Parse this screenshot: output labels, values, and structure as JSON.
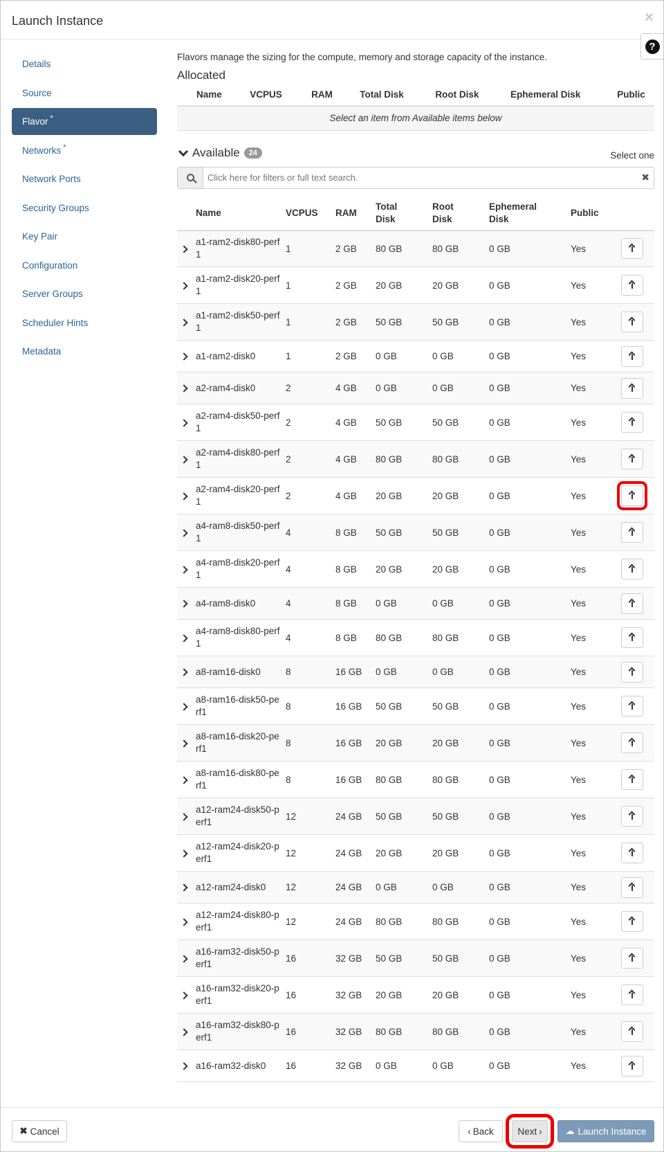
{
  "modal": {
    "title": "Launch Instance",
    "close": "×",
    "help": "?"
  },
  "sidebar": {
    "items": [
      {
        "label": "Details",
        "required": false,
        "active": false
      },
      {
        "label": "Source",
        "required": false,
        "active": false
      },
      {
        "label": "Flavor",
        "required": true,
        "active": true
      },
      {
        "label": "Networks",
        "required": true,
        "active": false
      },
      {
        "label": "Network Ports",
        "required": false,
        "active": false
      },
      {
        "label": "Security Groups",
        "required": false,
        "active": false
      },
      {
        "label": "Key Pair",
        "required": false,
        "active": false
      },
      {
        "label": "Configuration",
        "required": false,
        "active": false
      },
      {
        "label": "Server Groups",
        "required": false,
        "active": false
      },
      {
        "label": "Scheduler Hints",
        "required": false,
        "active": false
      },
      {
        "label": "Metadata",
        "required": false,
        "active": false
      }
    ],
    "required_mark": "*"
  },
  "flavor": {
    "description": "Flavors manage the sizing for the compute, memory and storage capacity of the instance.",
    "allocated": {
      "title": "Allocated",
      "columns": [
        "Name",
        "VCPUS",
        "RAM",
        "Total Disk",
        "Root Disk",
        "Ephemeral Disk",
        "Public"
      ],
      "empty_message": "Select an item from Available items below"
    },
    "available": {
      "title": "Available",
      "count": "24",
      "select_hint": "Select one",
      "search_placeholder": "Click here for filters or full text search.",
      "search_clear": "✖",
      "columns": [
        "Name",
        "VCPUS",
        "RAM",
        "Total Disk",
        "Root Disk",
        "Ephemeral Disk",
        "Public"
      ],
      "rows": [
        {
          "name": "a1-ram2-disk80-perf1",
          "vcpus": "1",
          "ram": "2 GB",
          "total_disk": "80 GB",
          "root_disk": "80 GB",
          "ephemeral_disk": "0 GB",
          "public": "Yes"
        },
        {
          "name": "a1-ram2-disk20-perf1",
          "vcpus": "1",
          "ram": "2 GB",
          "total_disk": "20 GB",
          "root_disk": "20 GB",
          "ephemeral_disk": "0 GB",
          "public": "Yes"
        },
        {
          "name": "a1-ram2-disk50-perf1",
          "vcpus": "1",
          "ram": "2 GB",
          "total_disk": "50 GB",
          "root_disk": "50 GB",
          "ephemeral_disk": "0 GB",
          "public": "Yes"
        },
        {
          "name": "a1-ram2-disk0",
          "vcpus": "1",
          "ram": "2 GB",
          "total_disk": "0 GB",
          "root_disk": "0 GB",
          "ephemeral_disk": "0 GB",
          "public": "Yes"
        },
        {
          "name": "a2-ram4-disk0",
          "vcpus": "2",
          "ram": "4 GB",
          "total_disk": "0 GB",
          "root_disk": "0 GB",
          "ephemeral_disk": "0 GB",
          "public": "Yes"
        },
        {
          "name": "a2-ram4-disk50-perf1",
          "vcpus": "2",
          "ram": "4 GB",
          "total_disk": "50 GB",
          "root_disk": "50 GB",
          "ephemeral_disk": "0 GB",
          "public": "Yes"
        },
        {
          "name": "a2-ram4-disk80-perf1",
          "vcpus": "2",
          "ram": "4 GB",
          "total_disk": "80 GB",
          "root_disk": "80 GB",
          "ephemeral_disk": "0 GB",
          "public": "Yes"
        },
        {
          "name": "a2-ram4-disk20-perf1",
          "vcpus": "2",
          "ram": "4 GB",
          "total_disk": "20 GB",
          "root_disk": "20 GB",
          "ephemeral_disk": "0 GB",
          "public": "Yes",
          "highlight": true
        },
        {
          "name": "a4-ram8-disk50-perf1",
          "vcpus": "4",
          "ram": "8 GB",
          "total_disk": "50 GB",
          "root_disk": "50 GB",
          "ephemeral_disk": "0 GB",
          "public": "Yes"
        },
        {
          "name": "a4-ram8-disk20-perf1",
          "vcpus": "4",
          "ram": "8 GB",
          "total_disk": "20 GB",
          "root_disk": "20 GB",
          "ephemeral_disk": "0 GB",
          "public": "Yes"
        },
        {
          "name": "a4-ram8-disk0",
          "vcpus": "4",
          "ram": "8 GB",
          "total_disk": "0 GB",
          "root_disk": "0 GB",
          "ephemeral_disk": "0 GB",
          "public": "Yes"
        },
        {
          "name": "a4-ram8-disk80-perf1",
          "vcpus": "4",
          "ram": "8 GB",
          "total_disk": "80 GB",
          "root_disk": "80 GB",
          "ephemeral_disk": "0 GB",
          "public": "Yes"
        },
        {
          "name": "a8-ram16-disk0",
          "vcpus": "8",
          "ram": "16 GB",
          "total_disk": "0 GB",
          "root_disk": "0 GB",
          "ephemeral_disk": "0 GB",
          "public": "Yes"
        },
        {
          "name": "a8-ram16-disk50-perf1",
          "vcpus": "8",
          "ram": "16 GB",
          "total_disk": "50 GB",
          "root_disk": "50 GB",
          "ephemeral_disk": "0 GB",
          "public": "Yes"
        },
        {
          "name": "a8-ram16-disk20-perf1",
          "vcpus": "8",
          "ram": "16 GB",
          "total_disk": "20 GB",
          "root_disk": "20 GB",
          "ephemeral_disk": "0 GB",
          "public": "Yes"
        },
        {
          "name": "a8-ram16-disk80-perf1",
          "vcpus": "8",
          "ram": "16 GB",
          "total_disk": "80 GB",
          "root_disk": "80 GB",
          "ephemeral_disk": "0 GB",
          "public": "Yes"
        },
        {
          "name": "a12-ram24-disk50-perf1",
          "vcpus": "12",
          "ram": "24 GB",
          "total_disk": "50 GB",
          "root_disk": "50 GB",
          "ephemeral_disk": "0 GB",
          "public": "Yes"
        },
        {
          "name": "a12-ram24-disk20-perf1",
          "vcpus": "12",
          "ram": "24 GB",
          "total_disk": "20 GB",
          "root_disk": "20 GB",
          "ephemeral_disk": "0 GB",
          "public": "Yes"
        },
        {
          "name": "a12-ram24-disk0",
          "vcpus": "12",
          "ram": "24 GB",
          "total_disk": "0 GB",
          "root_disk": "0 GB",
          "ephemeral_disk": "0 GB",
          "public": "Yes"
        },
        {
          "name": "a12-ram24-disk80-perf1",
          "vcpus": "12",
          "ram": "24 GB",
          "total_disk": "80 GB",
          "root_disk": "80 GB",
          "ephemeral_disk": "0 GB",
          "public": "Yes"
        },
        {
          "name": "a16-ram32-disk50-perf1",
          "vcpus": "16",
          "ram": "32 GB",
          "total_disk": "50 GB",
          "root_disk": "50 GB",
          "ephemeral_disk": "0 GB",
          "public": "Yes"
        },
        {
          "name": "a16-ram32-disk20-perf1",
          "vcpus": "16",
          "ram": "32 GB",
          "total_disk": "20 GB",
          "root_disk": "20 GB",
          "ephemeral_disk": "0 GB",
          "public": "Yes"
        },
        {
          "name": "a16-ram32-disk80-perf1",
          "vcpus": "16",
          "ram": "32 GB",
          "total_disk": "80 GB",
          "root_disk": "80 GB",
          "ephemeral_disk": "0 GB",
          "public": "Yes"
        },
        {
          "name": "a16-ram32-disk0",
          "vcpus": "16",
          "ram": "32 GB",
          "total_disk": "0 GB",
          "root_disk": "0 GB",
          "ephemeral_disk": "0 GB",
          "public": "Yes"
        }
      ]
    }
  },
  "footer": {
    "cancel_label": "Cancel",
    "cancel_icon": "✖",
    "back_label": "Back",
    "back_icon": "‹",
    "next_label": "Next",
    "next_icon": "›",
    "launch_label": "Launch Instance",
    "launch_icon": "☁"
  },
  "colors": {
    "accent": "#3a5f82",
    "link": "#2a6496",
    "highlight": "#ee0000",
    "launch_button": "#7d9bb8"
  }
}
